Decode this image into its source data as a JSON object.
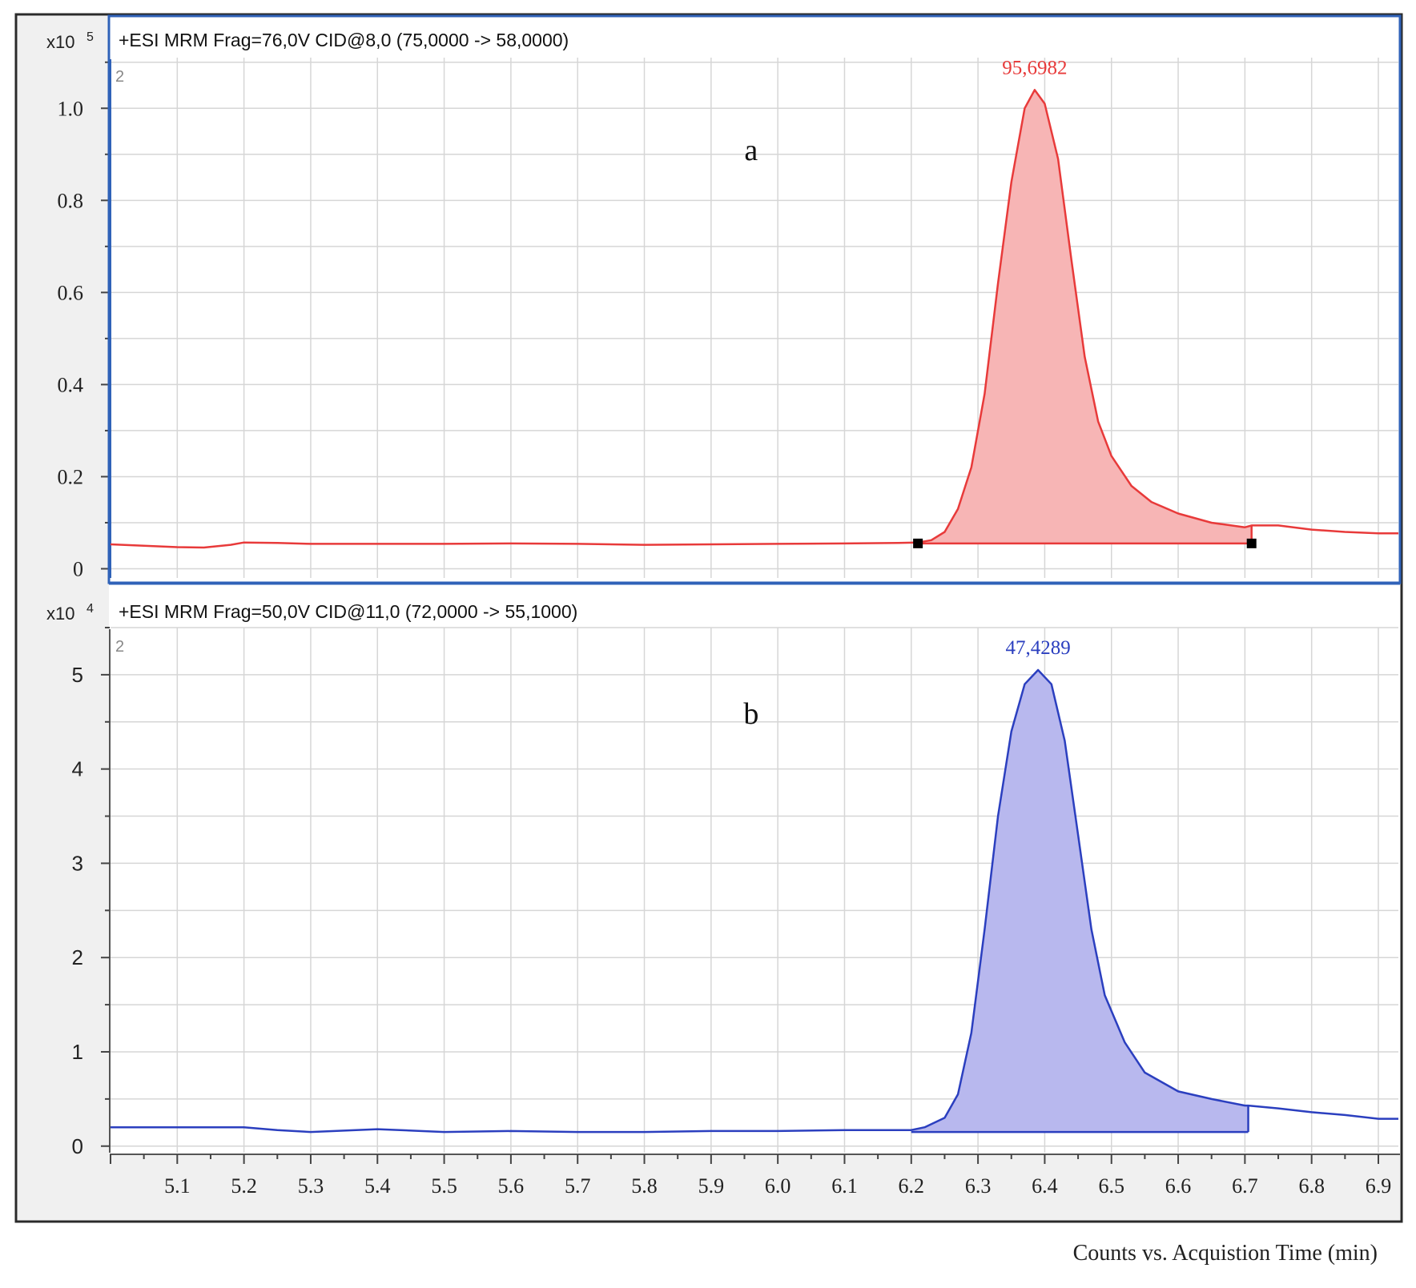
{
  "footer_label": "Counts vs. Acquistion Time (min)",
  "x_axis": {
    "ticks": [
      "5.1",
      "5.2",
      "5.3",
      "5.4",
      "5.5",
      "5.6",
      "5.7",
      "5.8",
      "5.9",
      "6.0",
      "6.1",
      "6.2",
      "6.3",
      "6.4",
      "6.5",
      "6.6",
      "6.7",
      "6.8",
      "6.9"
    ],
    "range": [
      5.0,
      6.93
    ]
  },
  "chart_data": [
    {
      "type": "area",
      "panel_letter": "a",
      "header": "+ESI MRM Frag=76,0V CID@8,0 (75,0000 -> 58,0000)",
      "scale_label": "x10",
      "scale_exp": "5",
      "panel_index": "2",
      "peak_label": "95,6982",
      "peak_time": 6.385,
      "xlim": [
        5.0,
        6.93
      ],
      "ylim": [
        -0.02,
        1.11
      ],
      "yticks": [
        "0",
        "0.2",
        "0.4",
        "0.6",
        "0.8",
        "1.0"
      ],
      "ytick_values": [
        0,
        0.2,
        0.4,
        0.6,
        0.8,
        1.0
      ],
      "grid": true,
      "color": "#e83a3a",
      "fill": "#f7b5b5",
      "integration": {
        "start": 6.21,
        "end": 6.71,
        "baseline_start": 0.055,
        "baseline_end": 0.055,
        "markers": true
      },
      "trace": {
        "x": [
          5.0,
          5.05,
          5.1,
          5.14,
          5.18,
          5.2,
          5.25,
          5.3,
          5.4,
          5.5,
          5.6,
          5.7,
          5.8,
          5.9,
          6.0,
          6.1,
          6.18,
          6.21,
          6.23,
          6.25,
          6.27,
          6.29,
          6.31,
          6.33,
          6.35,
          6.37,
          6.385,
          6.4,
          6.42,
          6.44,
          6.46,
          6.48,
          6.5,
          6.53,
          6.56,
          6.6,
          6.65,
          6.7,
          6.71,
          6.75,
          6.8,
          6.85,
          6.9,
          6.93
        ],
        "y": [
          0.053,
          0.05,
          0.047,
          0.046,
          0.052,
          0.057,
          0.056,
          0.054,
          0.054,
          0.054,
          0.055,
          0.054,
          0.052,
          0.053,
          0.054,
          0.055,
          0.056,
          0.057,
          0.062,
          0.08,
          0.13,
          0.22,
          0.38,
          0.62,
          0.84,
          1.0,
          1.04,
          1.01,
          0.89,
          0.67,
          0.46,
          0.32,
          0.245,
          0.18,
          0.145,
          0.12,
          0.1,
          0.09,
          0.094,
          0.094,
          0.085,
          0.08,
          0.077,
          0.077
        ]
      }
    },
    {
      "type": "area",
      "panel_letter": "b",
      "header": "+ESI MRM Frag=50,0V CID@11,0 (72,0000 -> 55,1000)",
      "scale_label": "x10",
      "scale_exp": "4",
      "panel_index": "2",
      "peak_label": "47,4289",
      "peak_time": 6.39,
      "xlim": [
        5.0,
        6.93
      ],
      "ylim": [
        -0.07,
        5.5
      ],
      "yticks": [
        "0",
        "1",
        "2",
        "3",
        "4",
        "5"
      ],
      "ytick_values": [
        0,
        1,
        2,
        3,
        4,
        5
      ],
      "grid": true,
      "color": "#2b3fbf",
      "fill": "#b8b8ee",
      "integration": {
        "start": 6.2,
        "end": 6.705,
        "baseline_start": 0.15,
        "baseline_end": 0.15,
        "markers": false
      },
      "trace": {
        "x": [
          5.0,
          5.05,
          5.1,
          5.15,
          5.2,
          5.25,
          5.3,
          5.4,
          5.5,
          5.6,
          5.7,
          5.8,
          5.9,
          6.0,
          6.1,
          6.18,
          6.2,
          6.22,
          6.25,
          6.27,
          6.29,
          6.31,
          6.33,
          6.35,
          6.37,
          6.39,
          6.41,
          6.43,
          6.45,
          6.47,
          6.49,
          6.52,
          6.55,
          6.6,
          6.65,
          6.7,
          6.705,
          6.75,
          6.8,
          6.85,
          6.9,
          6.93
        ],
        "y": [
          0.2,
          0.2,
          0.2,
          0.2,
          0.2,
          0.17,
          0.15,
          0.18,
          0.15,
          0.16,
          0.15,
          0.15,
          0.16,
          0.16,
          0.17,
          0.17,
          0.17,
          0.2,
          0.3,
          0.55,
          1.2,
          2.3,
          3.5,
          4.4,
          4.9,
          5.05,
          4.9,
          4.3,
          3.3,
          2.3,
          1.6,
          1.1,
          0.78,
          0.58,
          0.5,
          0.43,
          0.43,
          0.4,
          0.36,
          0.33,
          0.29,
          0.29
        ]
      }
    }
  ]
}
